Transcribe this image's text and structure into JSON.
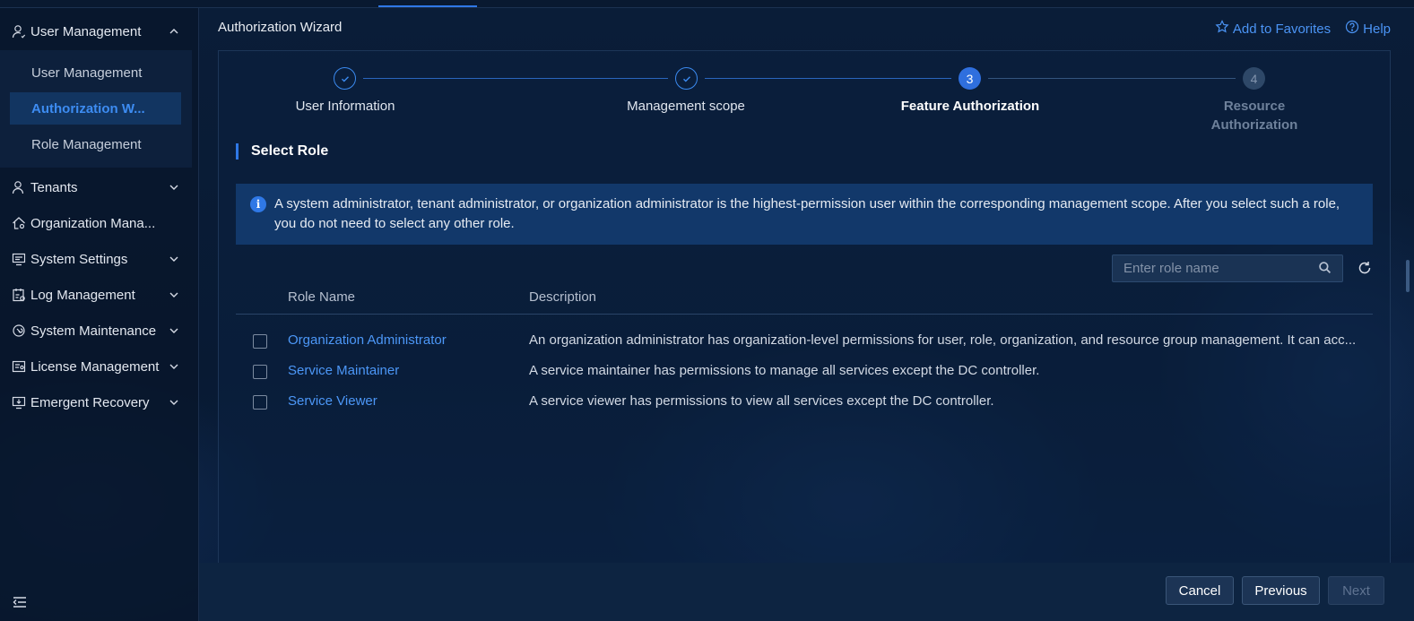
{
  "sidebar": {
    "group_open": {
      "label": "User Management",
      "icon": "user-icon"
    },
    "sub_items": [
      {
        "label": "User Management",
        "active": false
      },
      {
        "label": "Authorization W...",
        "active": true
      },
      {
        "label": "Role Management",
        "active": false
      }
    ],
    "groups": [
      {
        "label": "Tenants",
        "icon": "tenant-icon",
        "has_chevron": true
      },
      {
        "label": "Organization Mana...",
        "icon": "home-icon",
        "has_chevron": false
      },
      {
        "label": "System Settings",
        "icon": "settings-panel-icon",
        "has_chevron": true
      },
      {
        "label": "Log Management",
        "icon": "log-icon",
        "has_chevron": true
      },
      {
        "label": "System Maintenance",
        "icon": "maintenance-icon",
        "has_chevron": true
      },
      {
        "label": "License Management",
        "icon": "license-icon",
        "has_chevron": true
      },
      {
        "label": "Emergent Recovery",
        "icon": "recovery-icon",
        "has_chevron": true
      }
    ]
  },
  "header": {
    "title": "Authorization Wizard",
    "favorites_label": "Add to Favorites",
    "help_label": "Help"
  },
  "steps": [
    {
      "label": "User Information",
      "status": "done",
      "number": "1"
    },
    {
      "label": "Management scope",
      "status": "done",
      "number": "2"
    },
    {
      "label": "Feature Authorization",
      "status": "current",
      "number": "3"
    },
    {
      "label_line1": "Resource",
      "label_line2": "Authorization",
      "status": "pending",
      "number": "4"
    }
  ],
  "section": {
    "title": "Select Role"
  },
  "info": {
    "text": "A system administrator, tenant administrator, or organization administrator is the highest-permission user within the corresponding management scope. After you select such a role, you do not need to select any other role."
  },
  "search": {
    "placeholder": "Enter role name",
    "value": ""
  },
  "table": {
    "columns": [
      "Role Name",
      "Description"
    ],
    "rows": [
      {
        "name": "Organization Administrator",
        "description": "An organization administrator has organization-level permissions for user, role, organization, and resource group management. It can acc..."
      },
      {
        "name": "Service Maintainer",
        "description": "A service maintainer has permissions to manage all services except the DC controller."
      },
      {
        "name": "Service Viewer",
        "description": "A service viewer has permissions to view all services except the DC controller."
      }
    ]
  },
  "footer": {
    "cancel_label": "Cancel",
    "previous_label": "Previous",
    "next_label": "Next"
  },
  "colors": {
    "accent": "#2f78e6",
    "link": "#4c97f7",
    "background": "#071a33"
  }
}
